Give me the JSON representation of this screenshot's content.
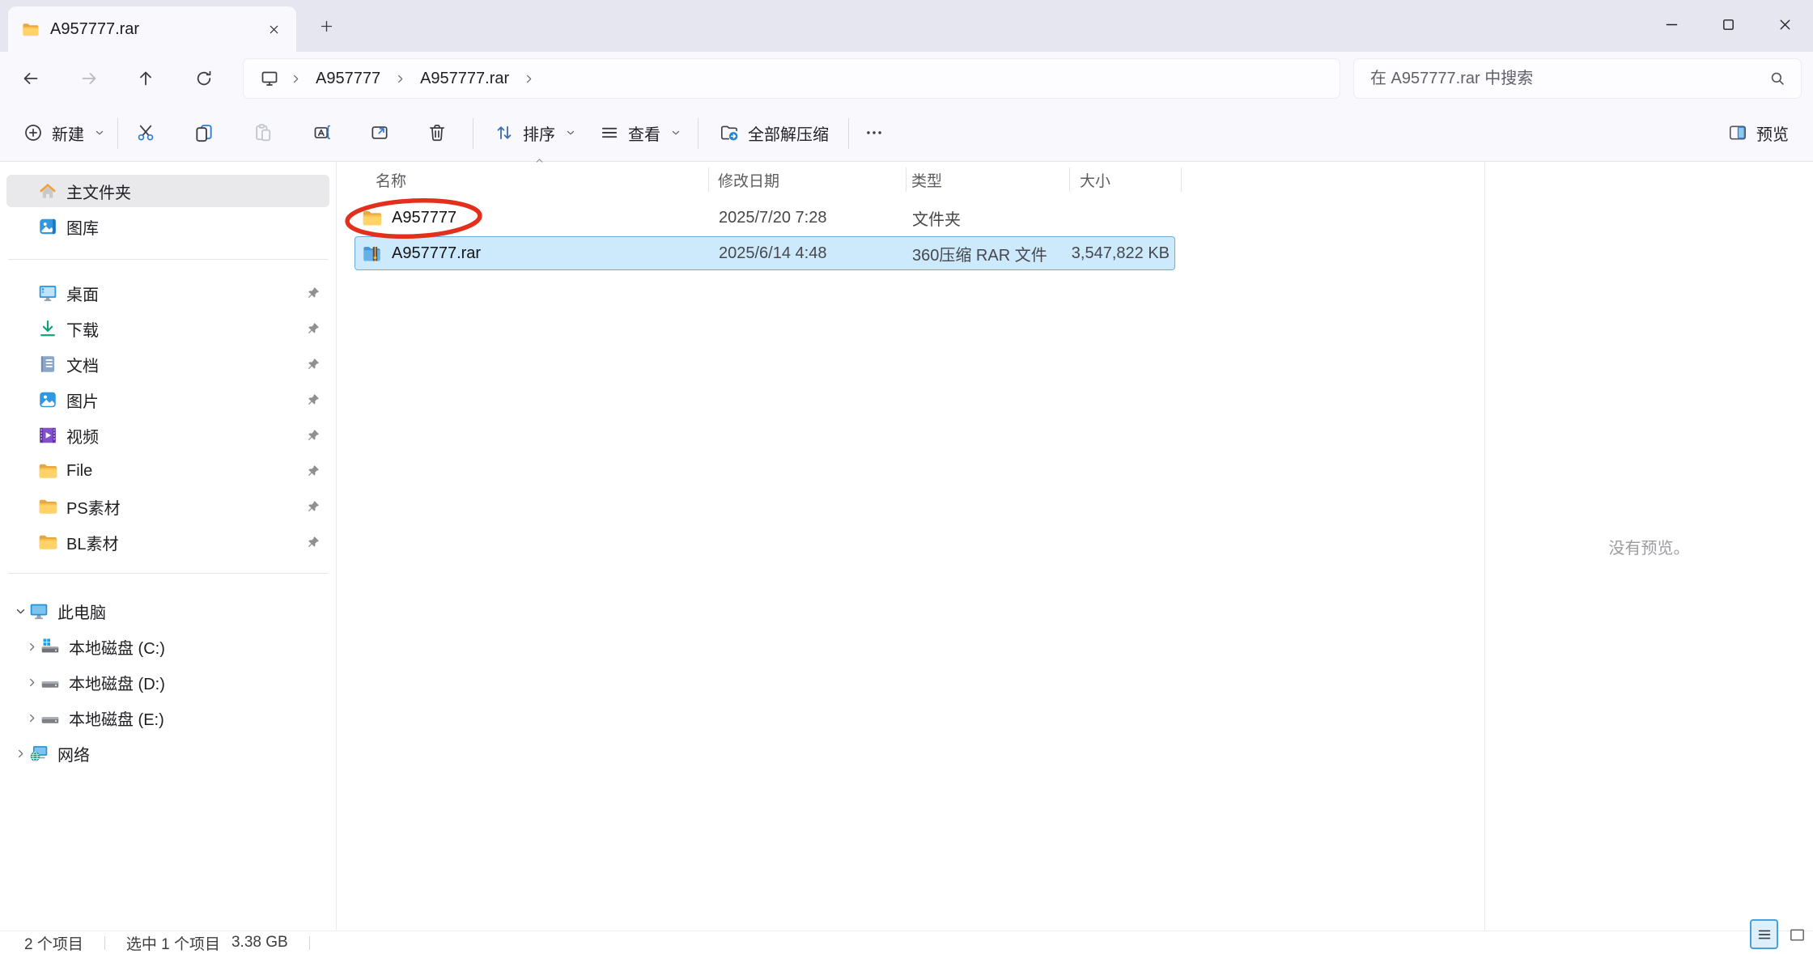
{
  "tab_bar": {
    "tab_title": "A957777.rar"
  },
  "navigation": {
    "breadcrumb_items": [
      "A957777",
      "A957777.rar"
    ],
    "search_placeholder": "在 A957777.rar 中搜索"
  },
  "toolbar": {
    "new": "新建",
    "sort": "排序",
    "view": "查看",
    "extract_all": "全部解压缩",
    "preview": "预览"
  },
  "sidebar": {
    "home_items": [
      {
        "label": "主文件夹",
        "icon": "home-icon",
        "selected": true
      },
      {
        "label": "图库",
        "icon": "gallery-icon",
        "selected": false
      }
    ],
    "pinned_items": [
      {
        "label": "桌面",
        "icon": "desktop-icon",
        "pinned": true
      },
      {
        "label": "下载",
        "icon": "downloads-icon",
        "pinned": true
      },
      {
        "label": "文档",
        "icon": "documents-icon",
        "pinned": true
      },
      {
        "label": "图片",
        "icon": "pictures-icon",
        "pinned": true
      },
      {
        "label": "视频",
        "icon": "videos-icon",
        "pinned": true
      },
      {
        "label": "File",
        "icon": "folder-icon",
        "pinned": true
      },
      {
        "label": "PS素材",
        "icon": "folder-icon",
        "pinned": true
      },
      {
        "label": "BL素材",
        "icon": "folder-icon",
        "pinned": true
      }
    ],
    "tree_items": [
      {
        "label": "此电脑",
        "icon": "computer-icon",
        "chevron": "down",
        "indent": 0
      },
      {
        "label": "本地磁盘 (C:)",
        "icon": "drive-windows-icon",
        "chevron": "right",
        "indent": 1
      },
      {
        "label": "本地磁盘 (D:)",
        "icon": "drive-icon",
        "chevron": "right",
        "indent": 1
      },
      {
        "label": "本地磁盘 (E:)",
        "icon": "drive-icon",
        "chevron": "right",
        "indent": 1
      },
      {
        "label": "网络",
        "icon": "network-icon",
        "chevron": "right",
        "indent": 0
      }
    ]
  },
  "file_list": {
    "columns": [
      "名称",
      "修改日期",
      "类型",
      "大小"
    ],
    "sort_column": "名称",
    "sort_direction": "asc",
    "rows": [
      {
        "name": "A957777",
        "icon": "folder-icon",
        "modified": "2025/7/20 7:28",
        "type": "文件夹",
        "size": "",
        "selected": false,
        "annotated": true
      },
      {
        "name": "A957777.rar",
        "icon": "rar-archive-icon",
        "modified": "2025/6/14 4:48",
        "type": "360压缩 RAR 文件",
        "size": "3,547,822 KB",
        "selected": true,
        "annotated": false
      }
    ]
  },
  "preview_pane": {
    "empty_text": "没有预览。"
  },
  "status_bar": {
    "item_count": "2 个项目",
    "selection_count": "选中 1 个项目",
    "selection_size": "3.38 GB"
  },
  "annotation": {
    "shape": "red-ellipse",
    "around": "A957777",
    "color": "#e3301c"
  },
  "colors": {
    "accent": "#2d7dd2",
    "selection_bg": "#cde9fc",
    "selection_border": "#69aede",
    "annotation_red": "#e3301c"
  }
}
